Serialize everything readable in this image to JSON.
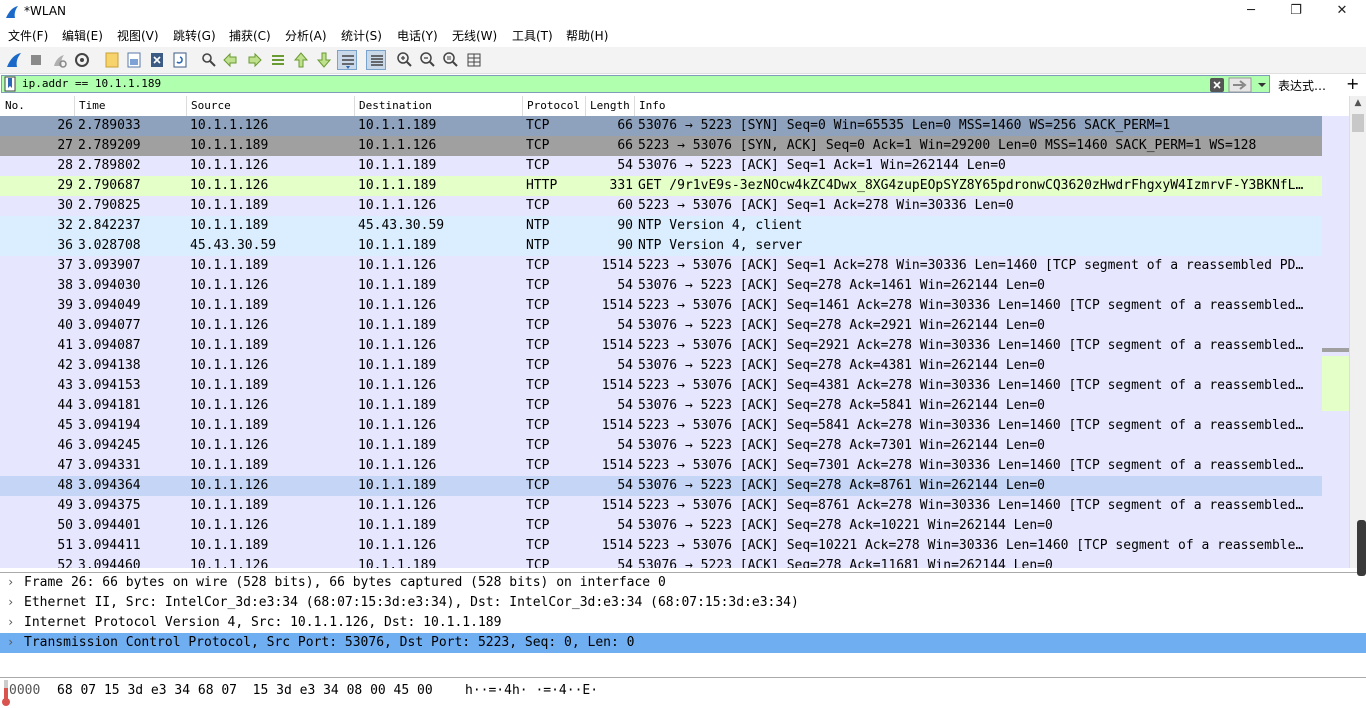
{
  "window": {
    "title": "*WLAN",
    "minimize": "─",
    "maximize": "❐",
    "close": "✕"
  },
  "menu": [
    "文件(F)",
    "编辑(E)",
    "视图(V)",
    "跳转(G)",
    "捕获(C)",
    "分析(A)",
    "统计(S)",
    "电话(Y)",
    "无线(W)",
    "工具(T)",
    "帮助(H)"
  ],
  "filter": {
    "value": "ip.addr == 10.1.1.189",
    "expression_label": "表达式…",
    "add": "+"
  },
  "columns": [
    "No.",
    "Time",
    "Source",
    "Destination",
    "Protocol",
    "Length",
    "Info"
  ],
  "colors": {
    "tcp": "#e7e6ff",
    "http": "#e4ffc7",
    "udp": "#daeeff",
    "syn": "#a0a0a0",
    "selected_row": "#8fa2bd",
    "hover_row": "#c4d5f5",
    "detail_selected": "#70aef2",
    "filter_ok": "#afffaf"
  },
  "packets": [
    {
      "no": "26",
      "time": "2.789033",
      "src": "10.1.1.126",
      "dst": "10.1.1.189",
      "proto": "TCP",
      "len": "66",
      "info": "53076 → 5223 [SYN] Seq=0 Win=65535 Len=0 MSS=1460 WS=256 SACK_PERM=1",
      "style": "selected_row"
    },
    {
      "no": "27",
      "time": "2.789209",
      "src": "10.1.1.189",
      "dst": "10.1.1.126",
      "proto": "TCP",
      "len": "66",
      "info": "5223 → 53076 [SYN, ACK] Seq=0 Ack=1 Win=29200 Len=0 MSS=1460 SACK_PERM=1 WS=128",
      "style": "syn"
    },
    {
      "no": "28",
      "time": "2.789802",
      "src": "10.1.1.126",
      "dst": "10.1.1.189",
      "proto": "TCP",
      "len": "54",
      "info": "53076 → 5223 [ACK] Seq=1 Ack=1 Win=262144 Len=0",
      "style": "tcp"
    },
    {
      "no": "29",
      "time": "2.790687",
      "src": "10.1.1.126",
      "dst": "10.1.1.189",
      "proto": "HTTP",
      "len": "331",
      "info": "GET /9r1vE9s-3ezNOcw4kZC4Dwx_8XG4zupEOpSYZ8Y65pdronwCQ3620zHwdrFhgxyW4IzmrvF-Y3BKNfL…",
      "style": "http"
    },
    {
      "no": "30",
      "time": "2.790825",
      "src": "10.1.1.189",
      "dst": "10.1.1.126",
      "proto": "TCP",
      "len": "60",
      "info": "5223 → 53076 [ACK] Seq=1 Ack=278 Win=30336 Len=0",
      "style": "tcp"
    },
    {
      "no": "32",
      "time": "2.842237",
      "src": "10.1.1.189",
      "dst": "45.43.30.59",
      "proto": "NTP",
      "len": "90",
      "info": "NTP Version 4, client",
      "style": "udp"
    },
    {
      "no": "36",
      "time": "3.028708",
      "src": "45.43.30.59",
      "dst": "10.1.1.189",
      "proto": "NTP",
      "len": "90",
      "info": "NTP Version 4, server",
      "style": "udp"
    },
    {
      "no": "37",
      "time": "3.093907",
      "src": "10.1.1.189",
      "dst": "10.1.1.126",
      "proto": "TCP",
      "len": "1514",
      "info": "5223 → 53076 [ACK] Seq=1 Ack=278 Win=30336 Len=1460 [TCP segment of a reassembled PD…",
      "style": "tcp"
    },
    {
      "no": "38",
      "time": "3.094030",
      "src": "10.1.1.126",
      "dst": "10.1.1.189",
      "proto": "TCP",
      "len": "54",
      "info": "53076 → 5223 [ACK] Seq=278 Ack=1461 Win=262144 Len=0",
      "style": "tcp"
    },
    {
      "no": "39",
      "time": "3.094049",
      "src": "10.1.1.189",
      "dst": "10.1.1.126",
      "proto": "TCP",
      "len": "1514",
      "info": "5223 → 53076 [ACK] Seq=1461 Ack=278 Win=30336 Len=1460 [TCP segment of a reassembled…",
      "style": "tcp"
    },
    {
      "no": "40",
      "time": "3.094077",
      "src": "10.1.1.126",
      "dst": "10.1.1.189",
      "proto": "TCP",
      "len": "54",
      "info": "53076 → 5223 [ACK] Seq=278 Ack=2921 Win=262144 Len=0",
      "style": "tcp"
    },
    {
      "no": "41",
      "time": "3.094087",
      "src": "10.1.1.189",
      "dst": "10.1.1.126",
      "proto": "TCP",
      "len": "1514",
      "info": "5223 → 53076 [ACK] Seq=2921 Ack=278 Win=30336 Len=1460 [TCP segment of a reassembled…",
      "style": "tcp"
    },
    {
      "no": "42",
      "time": "3.094138",
      "src": "10.1.1.126",
      "dst": "10.1.1.189",
      "proto": "TCP",
      "len": "54",
      "info": "53076 → 5223 [ACK] Seq=278 Ack=4381 Win=262144 Len=0",
      "style": "tcp"
    },
    {
      "no": "43",
      "time": "3.094153",
      "src": "10.1.1.189",
      "dst": "10.1.1.126",
      "proto": "TCP",
      "len": "1514",
      "info": "5223 → 53076 [ACK] Seq=4381 Ack=278 Win=30336 Len=1460 [TCP segment of a reassembled…",
      "style": "tcp"
    },
    {
      "no": "44",
      "time": "3.094181",
      "src": "10.1.1.126",
      "dst": "10.1.1.189",
      "proto": "TCP",
      "len": "54",
      "info": "53076 → 5223 [ACK] Seq=278 Ack=5841 Win=262144 Len=0",
      "style": "tcp"
    },
    {
      "no": "45",
      "time": "3.094194",
      "src": "10.1.1.189",
      "dst": "10.1.1.126",
      "proto": "TCP",
      "len": "1514",
      "info": "5223 → 53076 [ACK] Seq=5841 Ack=278 Win=30336 Len=1460 [TCP segment of a reassembled…",
      "style": "tcp"
    },
    {
      "no": "46",
      "time": "3.094245",
      "src": "10.1.1.126",
      "dst": "10.1.1.189",
      "proto": "TCP",
      "len": "54",
      "info": "53076 → 5223 [ACK] Seq=278 Ack=7301 Win=262144 Len=0",
      "style": "tcp"
    },
    {
      "no": "47",
      "time": "3.094331",
      "src": "10.1.1.189",
      "dst": "10.1.1.126",
      "proto": "TCP",
      "len": "1514",
      "info": "5223 → 53076 [ACK] Seq=7301 Ack=278 Win=30336 Len=1460 [TCP segment of a reassembled…",
      "style": "tcp"
    },
    {
      "no": "48",
      "time": "3.094364",
      "src": "10.1.1.126",
      "dst": "10.1.1.189",
      "proto": "TCP",
      "len": "54",
      "info": "53076 → 5223 [ACK] Seq=278 Ack=8761 Win=262144 Len=0",
      "style": "hover_row"
    },
    {
      "no": "49",
      "time": "3.094375",
      "src": "10.1.1.189",
      "dst": "10.1.1.126",
      "proto": "TCP",
      "len": "1514",
      "info": "5223 → 53076 [ACK] Seq=8761 Ack=278 Win=30336 Len=1460 [TCP segment of a reassembled…",
      "style": "tcp"
    },
    {
      "no": "50",
      "time": "3.094401",
      "src": "10.1.1.126",
      "dst": "10.1.1.189",
      "proto": "TCP",
      "len": "54",
      "info": "53076 → 5223 [ACK] Seq=278 Ack=10221 Win=262144 Len=0",
      "style": "tcp"
    },
    {
      "no": "51",
      "time": "3.094411",
      "src": "10.1.1.189",
      "dst": "10.1.1.126",
      "proto": "TCP",
      "len": "1514",
      "info": "5223 → 53076 [ACK] Seq=10221 Ack=278 Win=30336 Len=1460 [TCP segment of a reassemble…",
      "style": "tcp"
    },
    {
      "no": "52",
      "time": "3.094460",
      "src": "10.1.1.126",
      "dst": "10.1.1.189",
      "proto": "TCP",
      "len": "54",
      "info": "53076 → 5223 [ACK] Seq=278 Ack=11681 Win=262144 Len=0",
      "style": "tcp"
    }
  ],
  "details": [
    {
      "text": "Frame 26: 66 bytes on wire (528 bits), 66 bytes captured (528 bits) on interface 0",
      "selected": false
    },
    {
      "text": "Ethernet II, Src: IntelCor_3d:e3:34 (68:07:15:3d:e3:34), Dst: IntelCor_3d:e3:34 (68:07:15:3d:e3:34)",
      "selected": false
    },
    {
      "text": "Internet Protocol Version 4, Src: 10.1.1.126, Dst: 10.1.1.189",
      "selected": false
    },
    {
      "text": "Transmission Control Protocol, Src Port: 53076, Dst Port: 5223, Seq: 0, Len: 0",
      "selected": true
    }
  ],
  "hex": {
    "offset": "0000",
    "bytes": "68 07 15 3d e3 34 68 07  15 3d e3 34 08 00 45 00",
    "ascii": "h··=·4h· ·=·4··E·"
  },
  "icons": [
    "shark-fin-start-icon",
    "stop-icon",
    "restart-icon",
    "options-icon",
    "open-icon",
    "save-icon",
    "close-file-icon",
    "reload-icon",
    "search-icon",
    "back-icon",
    "forward-icon",
    "goto-icon",
    "first-icon",
    "last-icon",
    "autoscroll-icon",
    "colorize-icon",
    "zoom-in-icon",
    "zoom-out-icon",
    "zoom-normal-icon",
    "resize-columns-icon"
  ]
}
